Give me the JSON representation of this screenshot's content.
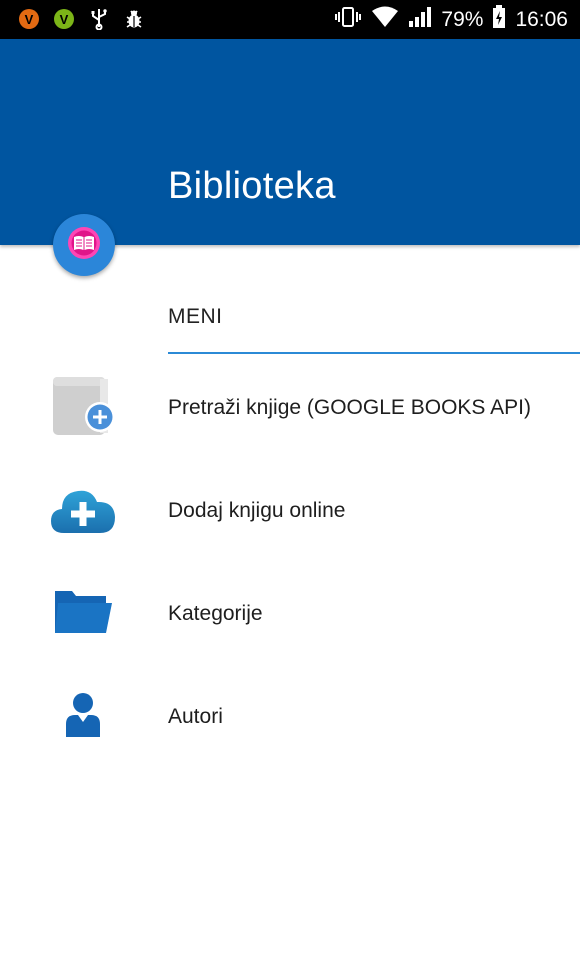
{
  "status_bar": {
    "battery": "79%",
    "time": "16:06"
  },
  "app_bar": {
    "title": "Biblioteka"
  },
  "menu": {
    "header": "MENI",
    "items": [
      {
        "label": "Pretraži knjige (GOOGLE BOOKS API)",
        "icon": "book-add-icon"
      },
      {
        "label": "Dodaj knjigu online",
        "icon": "cloud-add-icon"
      },
      {
        "label": "Kategorije",
        "icon": "folder-icon"
      },
      {
        "label": "Autori",
        "icon": "person-icon"
      }
    ]
  },
  "colors": {
    "app_bar": "#0055a0",
    "accent": "#2b8ad6",
    "fab": "#2b86d9",
    "fab_inner": "#e91e8c"
  }
}
